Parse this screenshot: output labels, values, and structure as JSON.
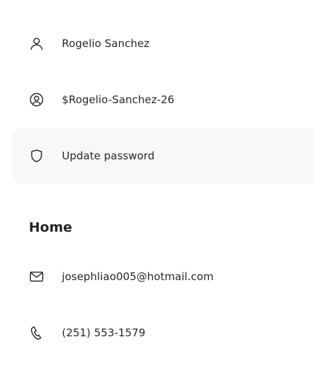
{
  "account": {
    "items": [
      {
        "icon": "person-icon",
        "label": "Rogelio Sanchez"
      },
      {
        "icon": "user-circle-icon",
        "label": "$Rogelio-Sanchez-26"
      },
      {
        "icon": "shield-icon",
        "label": "Update password"
      }
    ]
  },
  "home": {
    "title": "Home",
    "items": [
      {
        "icon": "mail-icon",
        "label": "josephliao005@hotmail.com"
      },
      {
        "icon": "phone-icon",
        "label": "(251) 553-1579"
      }
    ]
  }
}
